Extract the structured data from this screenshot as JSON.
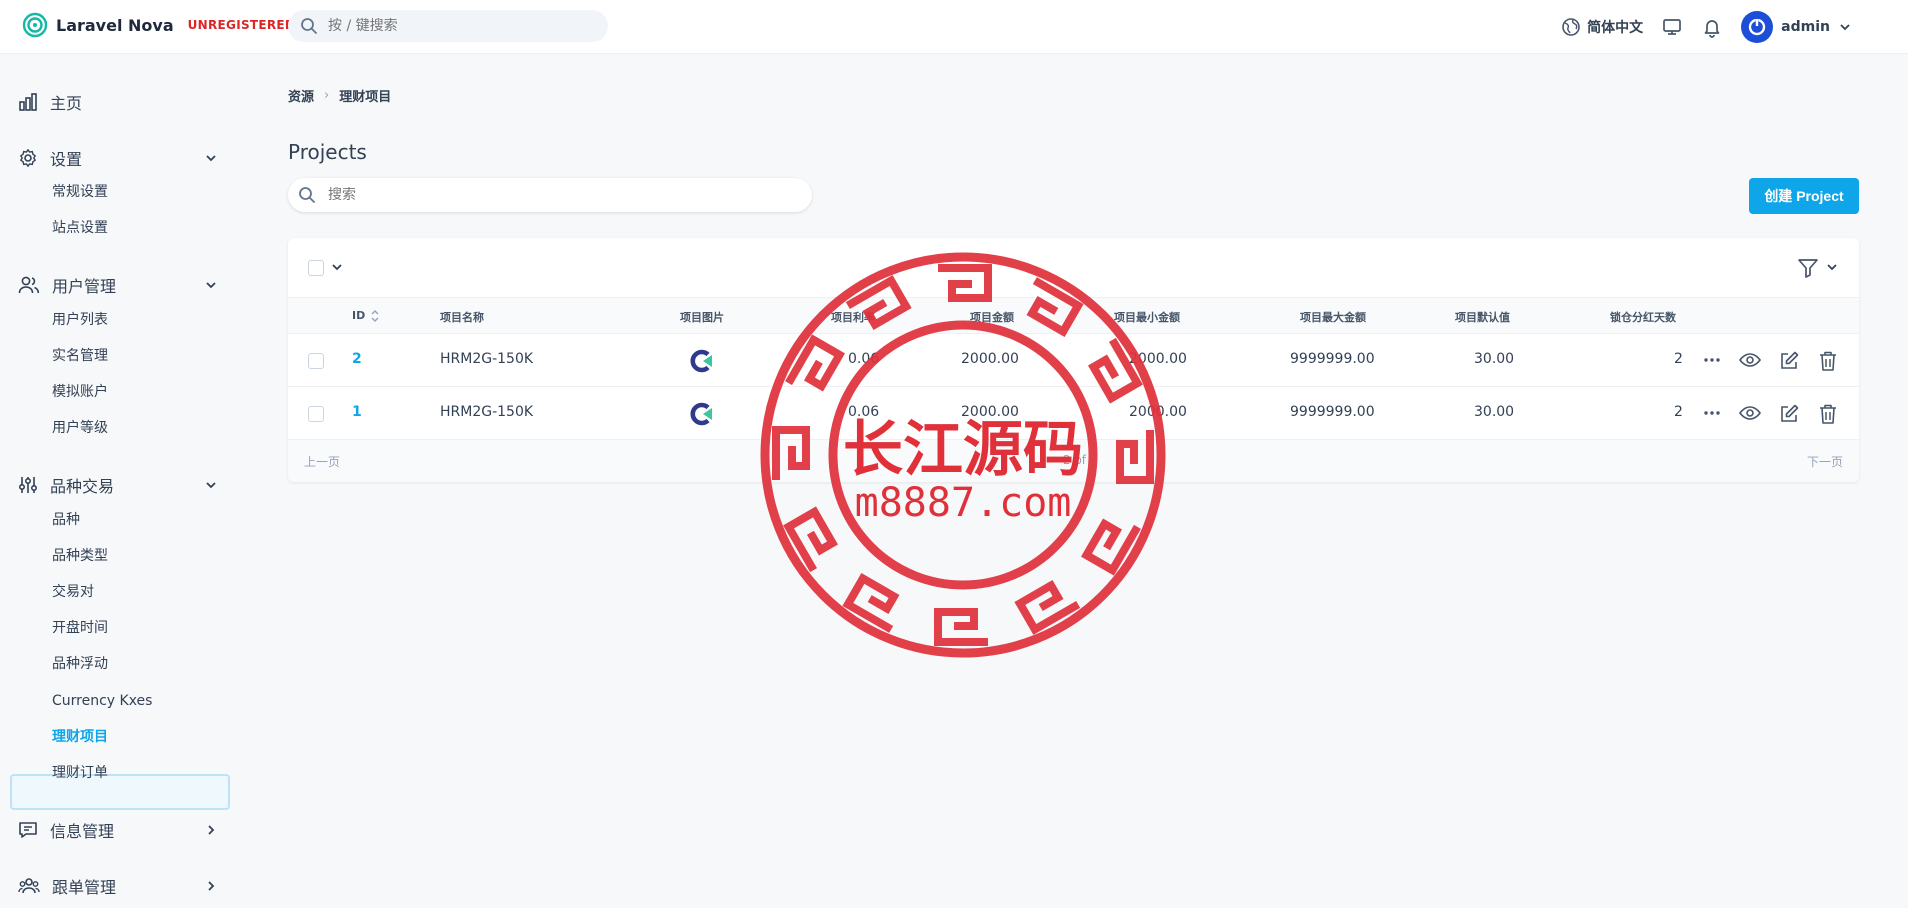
{
  "header": {
    "brand": "Laravel Nova",
    "badge": "UNREGISTERED",
    "search_placeholder": "按 / 键搜索",
    "language": "简体中文",
    "user": "admin"
  },
  "sidebar": {
    "home": "主页",
    "settings": {
      "label": "设置",
      "items": [
        "常规设置",
        "站点设置"
      ]
    },
    "users": {
      "label": "用户管理",
      "items": [
        "用户列表",
        "实名管理",
        "模拟账户",
        "用户等级"
      ]
    },
    "trading": {
      "label": "品种交易",
      "items": [
        "品种",
        "品种类型",
        "交易对",
        "开盘时间",
        "品种浮动",
        "Currency Kxes",
        "理财项目",
        "理财订单"
      ]
    },
    "messages": "信息管理",
    "copy": "跟单管理"
  },
  "breadcrumb": [
    "资源",
    "理财项目"
  ],
  "page": {
    "title": "Projects",
    "search_placeholder": "搜索",
    "create_button": "创建 Project"
  },
  "table": {
    "columns": [
      "ID",
      "项目名称",
      "项目图片",
      "项目利率",
      "项目金额",
      "项目最小金额",
      "项目最大金额",
      "项目默认值",
      "锁仓分红天数"
    ],
    "rows": [
      {
        "id": "2",
        "name": "HRM2G-150K",
        "rate": "0.06",
        "amount": "2000.00",
        "min": "2000.00",
        "max": "9999999.00",
        "default": "30.00",
        "days": "2"
      },
      {
        "id": "1",
        "name": "HRM2G-150K",
        "rate": "0.06",
        "amount": "2000.00",
        "min": "2000.00",
        "max": "9999999.00",
        "default": "30.00",
        "days": "2"
      }
    ]
  },
  "pagination": {
    "prev": "上一页",
    "info": "2 of",
    "next": "下一页"
  },
  "watermark": {
    "title": "长江源码",
    "url": "m8887.com"
  },
  "colors": {
    "accent": "#0ea5e9",
    "danger": "#dc2626",
    "stamp": "#e0303a"
  }
}
